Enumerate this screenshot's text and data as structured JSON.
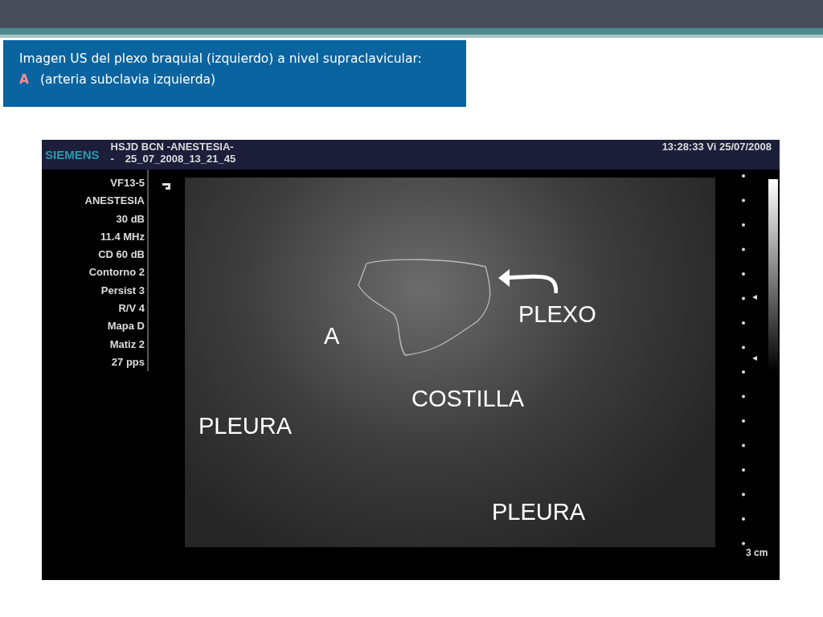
{
  "caption": {
    "heading": "Imagen US del plexo braquial (izquierdo) a nivel supraclavicular:",
    "legend_key": "A",
    "legend_text": "(arteria subclavia izquierda)"
  },
  "ultrasound": {
    "brand": "SIEMENS",
    "header_title": "HSJD BCN -ANESTESIA-",
    "header_mark": "-",
    "header_file": "25_07_2008_13_21_45",
    "datetime": "13:28:33  Vi  25/07/2008",
    "parameters": [
      "VF13-5",
      "ANESTESIA",
      "30 dB",
      "11.4 MHz",
      "CD 60 dB",
      "Contorno 2",
      "Persist 3",
      "R/V 4",
      "Mapa D",
      "Matiz 2",
      "27 pps"
    ],
    "labels": [
      {
        "text": "A"
      },
      {
        "text": "PLEXO"
      },
      {
        "text": "COSTILLA"
      },
      {
        "text": "PLEURA"
      },
      {
        "text": "PLEURA"
      }
    ],
    "scale": "3 cm"
  }
}
